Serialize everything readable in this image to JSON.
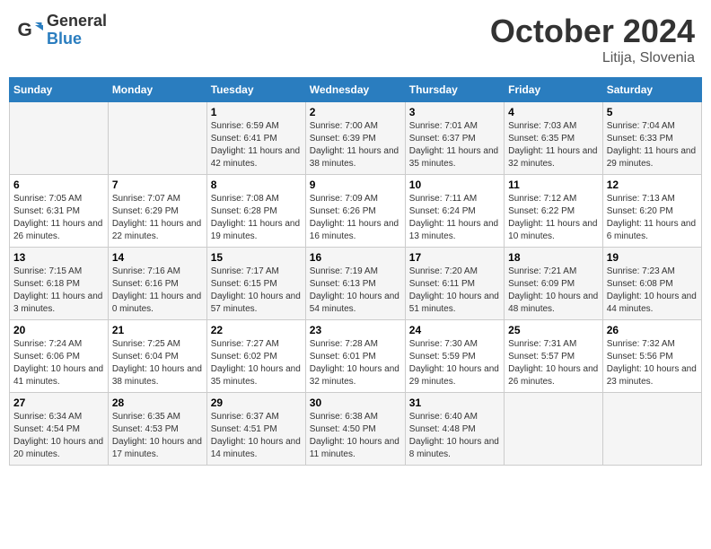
{
  "header": {
    "logo_general": "General",
    "logo_blue": "Blue",
    "month_title": "October 2024",
    "location": "Litija, Slovenia"
  },
  "days_of_week": [
    "Sunday",
    "Monday",
    "Tuesday",
    "Wednesday",
    "Thursday",
    "Friday",
    "Saturday"
  ],
  "weeks": [
    [
      {
        "day": "",
        "info": ""
      },
      {
        "day": "",
        "info": ""
      },
      {
        "day": "1",
        "sunrise": "6:59 AM",
        "sunset": "6:41 PM",
        "daylight": "11 hours and 42 minutes."
      },
      {
        "day": "2",
        "sunrise": "7:00 AM",
        "sunset": "6:39 PM",
        "daylight": "11 hours and 38 minutes."
      },
      {
        "day": "3",
        "sunrise": "7:01 AM",
        "sunset": "6:37 PM",
        "daylight": "11 hours and 35 minutes."
      },
      {
        "day": "4",
        "sunrise": "7:03 AM",
        "sunset": "6:35 PM",
        "daylight": "11 hours and 32 minutes."
      },
      {
        "day": "5",
        "sunrise": "7:04 AM",
        "sunset": "6:33 PM",
        "daylight": "11 hours and 29 minutes."
      }
    ],
    [
      {
        "day": "6",
        "sunrise": "7:05 AM",
        "sunset": "6:31 PM",
        "daylight": "11 hours and 26 minutes."
      },
      {
        "day": "7",
        "sunrise": "7:07 AM",
        "sunset": "6:29 PM",
        "daylight": "11 hours and 22 minutes."
      },
      {
        "day": "8",
        "sunrise": "7:08 AM",
        "sunset": "6:28 PM",
        "daylight": "11 hours and 19 minutes."
      },
      {
        "day": "9",
        "sunrise": "7:09 AM",
        "sunset": "6:26 PM",
        "daylight": "11 hours and 16 minutes."
      },
      {
        "day": "10",
        "sunrise": "7:11 AM",
        "sunset": "6:24 PM",
        "daylight": "11 hours and 13 minutes."
      },
      {
        "day": "11",
        "sunrise": "7:12 AM",
        "sunset": "6:22 PM",
        "daylight": "11 hours and 10 minutes."
      },
      {
        "day": "12",
        "sunrise": "7:13 AM",
        "sunset": "6:20 PM",
        "daylight": "11 hours and 6 minutes."
      }
    ],
    [
      {
        "day": "13",
        "sunrise": "7:15 AM",
        "sunset": "6:18 PM",
        "daylight": "11 hours and 3 minutes."
      },
      {
        "day": "14",
        "sunrise": "7:16 AM",
        "sunset": "6:16 PM",
        "daylight": "11 hours and 0 minutes."
      },
      {
        "day": "15",
        "sunrise": "7:17 AM",
        "sunset": "6:15 PM",
        "daylight": "10 hours and 57 minutes."
      },
      {
        "day": "16",
        "sunrise": "7:19 AM",
        "sunset": "6:13 PM",
        "daylight": "10 hours and 54 minutes."
      },
      {
        "day": "17",
        "sunrise": "7:20 AM",
        "sunset": "6:11 PM",
        "daylight": "10 hours and 51 minutes."
      },
      {
        "day": "18",
        "sunrise": "7:21 AM",
        "sunset": "6:09 PM",
        "daylight": "10 hours and 48 minutes."
      },
      {
        "day": "19",
        "sunrise": "7:23 AM",
        "sunset": "6:08 PM",
        "daylight": "10 hours and 44 minutes."
      }
    ],
    [
      {
        "day": "20",
        "sunrise": "7:24 AM",
        "sunset": "6:06 PM",
        "daylight": "10 hours and 41 minutes."
      },
      {
        "day": "21",
        "sunrise": "7:25 AM",
        "sunset": "6:04 PM",
        "daylight": "10 hours and 38 minutes."
      },
      {
        "day": "22",
        "sunrise": "7:27 AM",
        "sunset": "6:02 PM",
        "daylight": "10 hours and 35 minutes."
      },
      {
        "day": "23",
        "sunrise": "7:28 AM",
        "sunset": "6:01 PM",
        "daylight": "10 hours and 32 minutes."
      },
      {
        "day": "24",
        "sunrise": "7:30 AM",
        "sunset": "5:59 PM",
        "daylight": "10 hours and 29 minutes."
      },
      {
        "day": "25",
        "sunrise": "7:31 AM",
        "sunset": "5:57 PM",
        "daylight": "10 hours and 26 minutes."
      },
      {
        "day": "26",
        "sunrise": "7:32 AM",
        "sunset": "5:56 PM",
        "daylight": "10 hours and 23 minutes."
      }
    ],
    [
      {
        "day": "27",
        "sunrise": "6:34 AM",
        "sunset": "4:54 PM",
        "daylight": "10 hours and 20 minutes."
      },
      {
        "day": "28",
        "sunrise": "6:35 AM",
        "sunset": "4:53 PM",
        "daylight": "10 hours and 17 minutes."
      },
      {
        "day": "29",
        "sunrise": "6:37 AM",
        "sunset": "4:51 PM",
        "daylight": "10 hours and 14 minutes."
      },
      {
        "day": "30",
        "sunrise": "6:38 AM",
        "sunset": "4:50 PM",
        "daylight": "10 hours and 11 minutes."
      },
      {
        "day": "31",
        "sunrise": "6:40 AM",
        "sunset": "4:48 PM",
        "daylight": "10 hours and 8 minutes."
      },
      {
        "day": "",
        "info": ""
      },
      {
        "day": "",
        "info": ""
      }
    ]
  ]
}
